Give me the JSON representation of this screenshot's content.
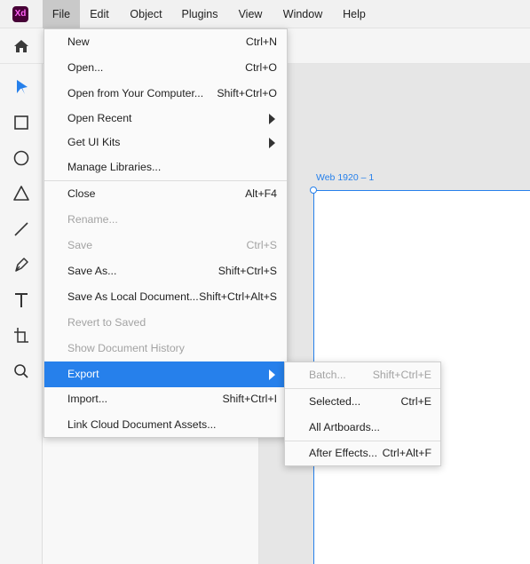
{
  "app": {
    "logo_text": "Xd",
    "brand_color": "#470137",
    "accent": "#2680eb"
  },
  "menubar": {
    "items": [
      {
        "label": "File"
      },
      {
        "label": "Edit"
      },
      {
        "label": "Object"
      },
      {
        "label": "Plugins"
      },
      {
        "label": "View"
      },
      {
        "label": "Window"
      },
      {
        "label": "Help"
      }
    ],
    "active": "File"
  },
  "toolbar": {
    "home_icon": "home-icon"
  },
  "tools": [
    "select-arrow-icon",
    "rectangle-icon",
    "ellipse-icon",
    "triangle-icon",
    "line-icon",
    "pen-icon",
    "text-icon",
    "artboard-icon",
    "zoom-icon"
  ],
  "canvas": {
    "artboard_label": "Web 1920 – 1"
  },
  "file_menu": {
    "items": [
      {
        "label": "New",
        "shortcut": "Ctrl+N"
      },
      {
        "label": "Open...",
        "shortcut": "Ctrl+O"
      },
      {
        "label": "Open from Your Computer...",
        "shortcut": "Shift+Ctrl+O"
      },
      {
        "label": "Open Recent",
        "submenu": true
      },
      {
        "label": "Get UI Kits",
        "submenu": true
      },
      {
        "label": "Manage Libraries..."
      },
      {
        "label": "Close",
        "shortcut": "Alt+F4"
      },
      {
        "label": "Rename...",
        "disabled": true
      },
      {
        "label": "Save",
        "shortcut": "Ctrl+S",
        "disabled": true
      },
      {
        "label": "Save As...",
        "shortcut": "Shift+Ctrl+S"
      },
      {
        "label": "Save As Local Document...",
        "shortcut": "Shift+Ctrl+Alt+S"
      },
      {
        "label": "Revert to Saved",
        "disabled": true
      },
      {
        "label": "Show Document History",
        "disabled": true
      },
      {
        "label": "Export",
        "submenu": true,
        "highlighted": true
      },
      {
        "label": "Import...",
        "shortcut": "Shift+Ctrl+I"
      },
      {
        "label": "Link Cloud Document Assets..."
      }
    ]
  },
  "export_menu": {
    "items": [
      {
        "label": "Batch...",
        "shortcut": "Shift+Ctrl+E",
        "disabled": true
      },
      {
        "label": "Selected...",
        "shortcut": "Ctrl+E"
      },
      {
        "label": "All Artboards..."
      },
      {
        "label": "After Effects...",
        "shortcut": "Ctrl+Alt+F"
      }
    ]
  }
}
